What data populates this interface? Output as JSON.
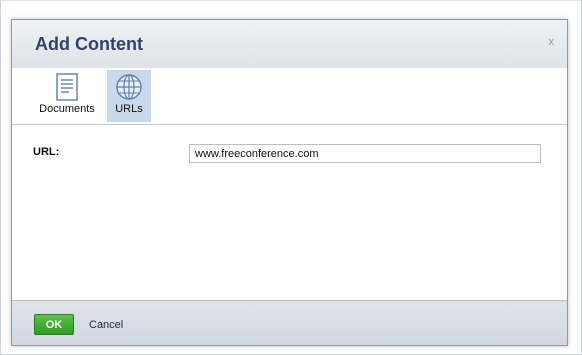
{
  "dialog": {
    "title": "Add Content",
    "close_label": "x"
  },
  "toolbar": {
    "items": [
      {
        "label": "Documents",
        "icon": "document-icon",
        "selected": false
      },
      {
        "label": "URLs",
        "icon": "globe-icon",
        "selected": true
      }
    ]
  },
  "form": {
    "url_label": "URL:",
    "url_value": "www.freeconference.com"
  },
  "footer": {
    "ok_label": "OK",
    "cancel_label": "Cancel"
  },
  "colors": {
    "title": "#2f4468",
    "selected_tool_bg": "#c9d8ea",
    "ok_button": "#3aa92e"
  }
}
